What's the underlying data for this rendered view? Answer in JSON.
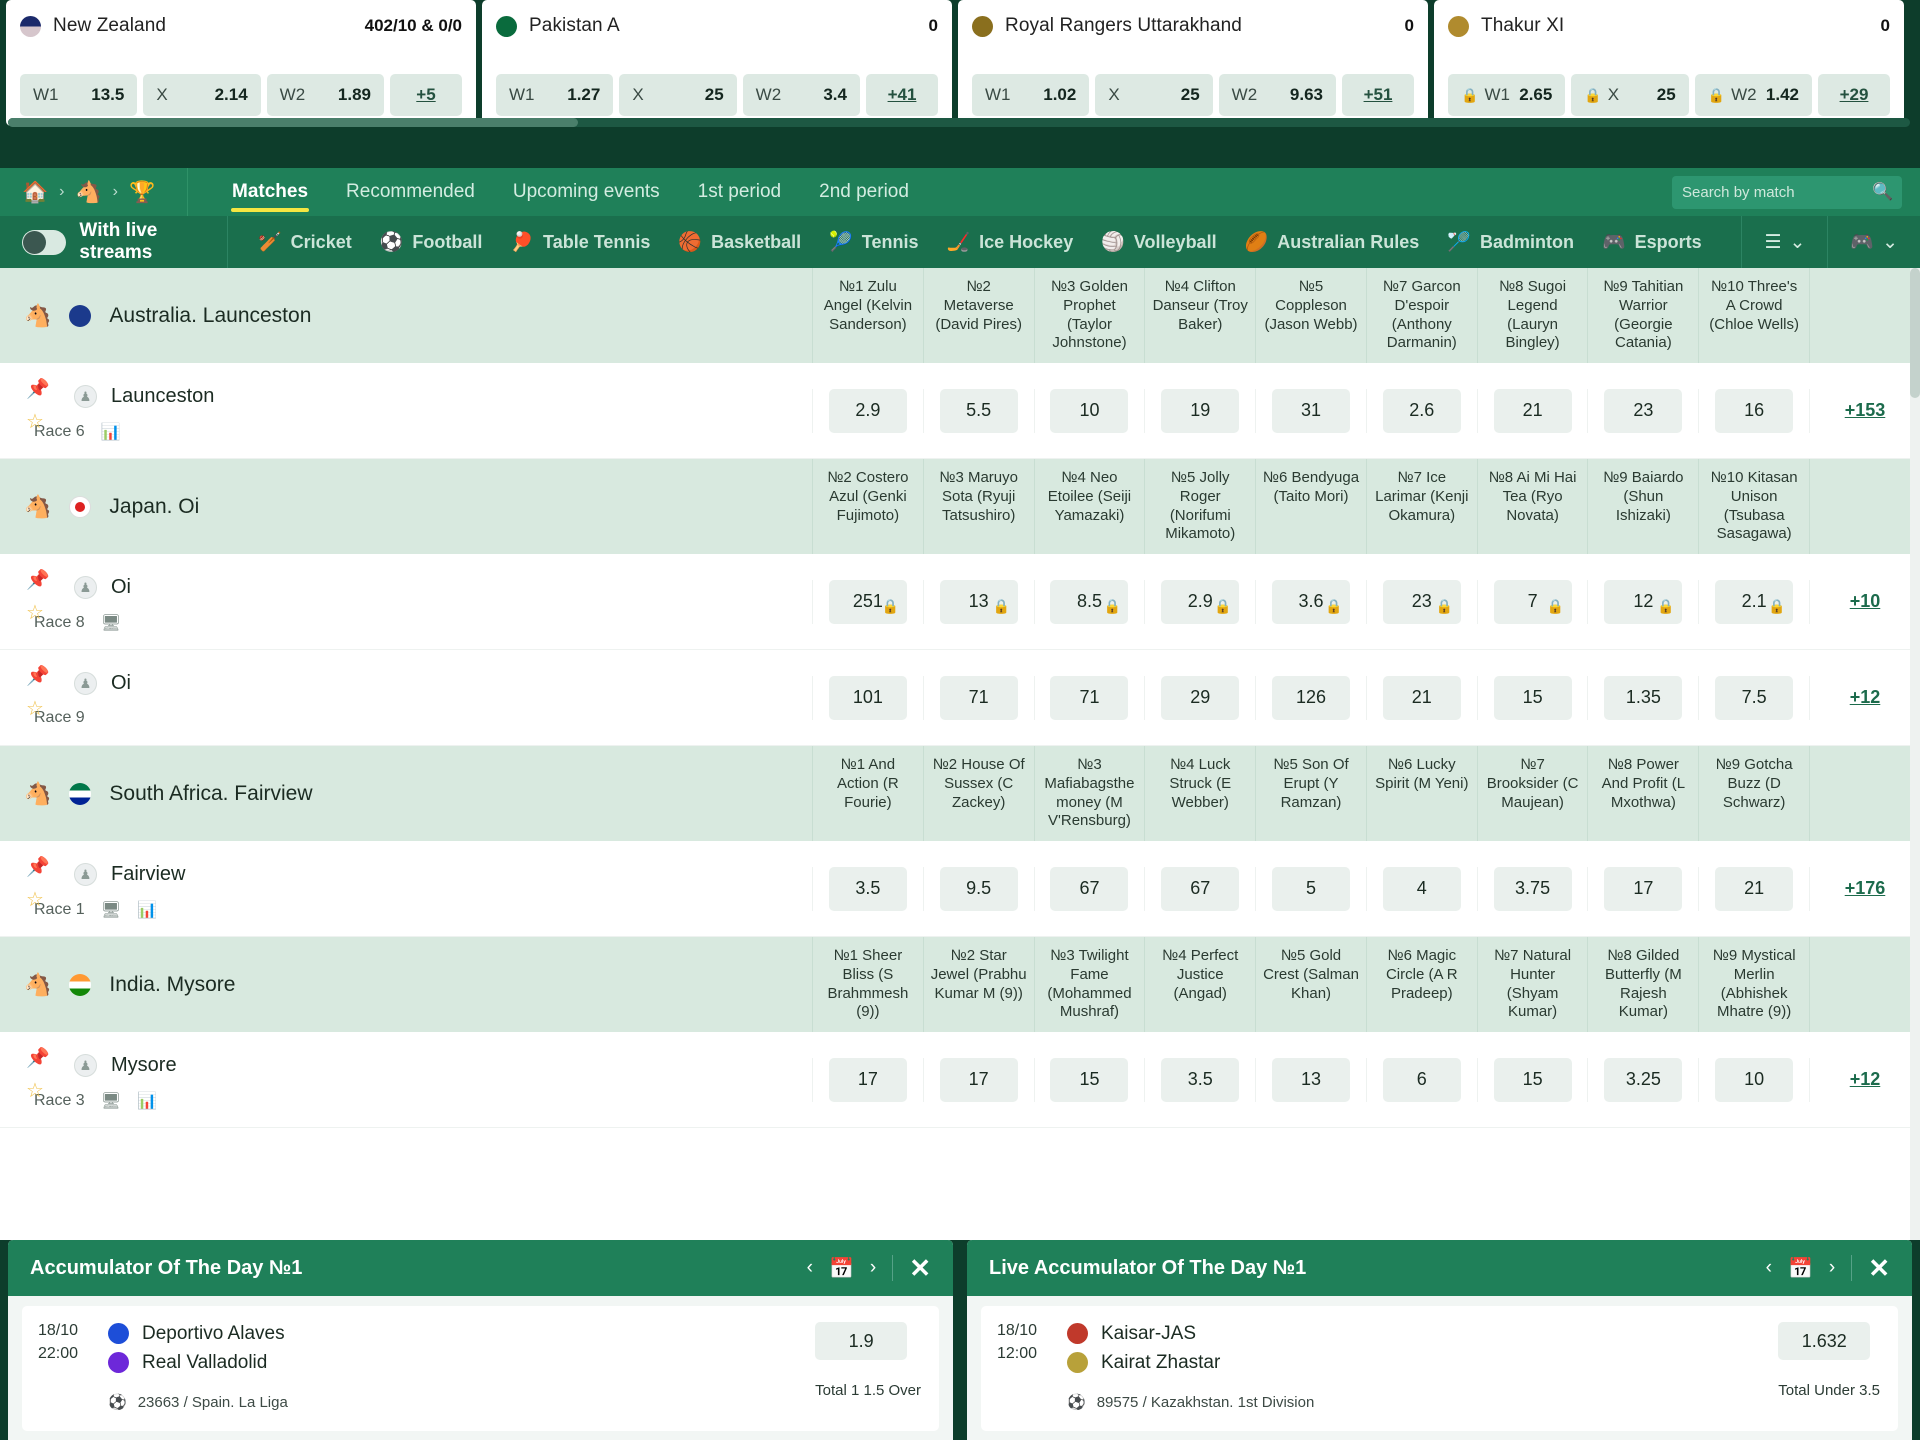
{
  "live_strip": {
    "matches": [
      {
        "team": "New Zealand",
        "flag": "nz",
        "score": "402/10 & 0/0",
        "odds": [
          {
            "label": "W1",
            "value": "13.5",
            "locked": false
          },
          {
            "label": "X",
            "value": "2.14",
            "locked": false
          },
          {
            "label": "W2",
            "value": "1.89",
            "locked": false
          }
        ],
        "more": "+5"
      },
      {
        "team": "Pakistan A",
        "flag": "pk",
        "score": "0",
        "odds": [
          {
            "label": "W1",
            "value": "1.27",
            "locked": false
          },
          {
            "label": "X",
            "value": "25",
            "locked": false
          },
          {
            "label": "W2",
            "value": "3.4",
            "locked": false
          }
        ],
        "more": "+41"
      },
      {
        "team": "Royal Rangers Uttarakhand",
        "flag": "rr",
        "score": "0",
        "odds": [
          {
            "label": "W1",
            "value": "1.02",
            "locked": false
          },
          {
            "label": "X",
            "value": "25",
            "locked": false
          },
          {
            "label": "W2",
            "value": "9.63",
            "locked": false
          }
        ],
        "more": "+51"
      },
      {
        "team": "Thakur XI",
        "flag": "tx",
        "score": "0",
        "odds": [
          {
            "label": "W1",
            "value": "2.65",
            "locked": true
          },
          {
            "label": "X",
            "value": "25",
            "locked": true
          },
          {
            "label": "W2",
            "value": "1.42",
            "locked": true
          }
        ],
        "more": "+29"
      }
    ]
  },
  "nav": {
    "breadcrumb": [
      "home-icon",
      "horse-racing-icon",
      "trophy-icon"
    ],
    "tabs": [
      {
        "label": "Matches",
        "active": true
      },
      {
        "label": "Recommended",
        "active": false
      },
      {
        "label": "Upcoming events",
        "active": false
      },
      {
        "label": "1st period",
        "active": false
      },
      {
        "label": "2nd period",
        "active": false
      }
    ],
    "search": {
      "placeholder": "Search by match",
      "value": ""
    }
  },
  "sports_bar": {
    "live_streams_toggle": {
      "label": "With live streams",
      "on": false
    },
    "sports": [
      {
        "label": "Cricket",
        "icon": "cricket-icon"
      },
      {
        "label": "Football",
        "icon": "football-icon"
      },
      {
        "label": "Table Tennis",
        "icon": "table-tennis-icon"
      },
      {
        "label": "Basketball",
        "icon": "basketball-icon"
      },
      {
        "label": "Tennis",
        "icon": "tennis-icon"
      },
      {
        "label": "Ice Hockey",
        "icon": "ice-hockey-icon"
      },
      {
        "label": "Volleyball",
        "icon": "volleyball-icon"
      },
      {
        "label": "Australian Rules",
        "icon": "australian-rules-icon"
      },
      {
        "label": "Badminton",
        "icon": "badminton-icon"
      },
      {
        "label": "Esports",
        "icon": "esports-icon"
      }
    ],
    "right_controls": [
      {
        "icon": "list-icon",
        "chevron": "⌄"
      },
      {
        "icon": "gamepad-icon",
        "chevron": "⌄"
      }
    ]
  },
  "groups": [
    {
      "country": "Australia. Launceston",
      "flag": "au",
      "runners": [
        "№1 Zulu Angel (Kelvin Sanderson)",
        "№2 Metaverse (David Pires)",
        "№3 Golden Prophet (Taylor Johnstone)",
        "№4 Clifton Danseur (Troy Baker)",
        "№5 Coppleson (Jason Webb)",
        "№7 Garcon D'espoir (Anthony Darmanin)",
        "№8 Sugoi Legend (Lauryn Bingley)",
        "№9 Tahitian Warrior (Georgie Catania)",
        "№10 Three's A Crowd (Chloe Wells)"
      ],
      "events": [
        {
          "name": "Launceston",
          "race": "Race 6",
          "meta_icons": [
            "stats-icon"
          ],
          "odds": [
            "2.9",
            "5.5",
            "10",
            "19",
            "31",
            "2.6",
            "21",
            "23",
            "16"
          ],
          "locked": false,
          "more": "+153"
        }
      ]
    },
    {
      "country": "Japan. Oi",
      "flag": "jp",
      "runners": [
        "№2 Costero Azul (Genki Fujimoto)",
        "№3 Maruyo Sota (Ryuji Tatsushiro)",
        "№4 Neo Etoilee (Seiji Yamazaki)",
        "№5 Jolly Roger (Norifumi Mikamoto)",
        "№6 Bendyuga (Taito Mori)",
        "№7 Ice Larimar (Kenji Okamura)",
        "№8 Ai Mi Hai Tea (Ryo Novata)",
        "№9 Baiardo (Shun Ishizaki)",
        "№10 Kitasan Unison (Tsubasa Sasagawa)"
      ],
      "events": [
        {
          "name": "Oi",
          "race": "Race 8",
          "meta_icons": [
            "stream-icon"
          ],
          "odds": [
            "251",
            "13",
            "8.5",
            "2.9",
            "3.6",
            "23",
            "7",
            "12",
            "2.1"
          ],
          "locked": true,
          "more": "+10"
        },
        {
          "name": "Oi",
          "race": "Race 9",
          "meta_icons": [],
          "odds": [
            "101",
            "71",
            "71",
            "29",
            "126",
            "21",
            "15",
            "1.35",
            "7.5"
          ],
          "locked": false,
          "more": "+12"
        }
      ]
    },
    {
      "country": "South Africa. Fairview",
      "flag": "za",
      "runners": [
        "№1 And Action (R Fourie)",
        "№2 House Of Sussex (C Zackey)",
        "№3 Mafiabagsthemoney (M V'Rensburg)",
        "№4 Luck Struck (E Webber)",
        "№5 Son Of Erupt (Y Ramzan)",
        "№6 Lucky Spirit (M Yeni)",
        "№7 Brooksider (C Maujean)",
        "№8 Power And Profit (L Mxothwa)",
        "№9 Gotcha Buzz (D Schwarz)"
      ],
      "events": [
        {
          "name": "Fairview",
          "race": "Race 1",
          "meta_icons": [
            "stream-icon",
            "stats-icon"
          ],
          "odds": [
            "3.5",
            "9.5",
            "67",
            "67",
            "5",
            "4",
            "3.75",
            "17",
            "21"
          ],
          "locked": false,
          "more": "+176"
        }
      ]
    },
    {
      "country": "India. Mysore",
      "flag": "in",
      "runners": [
        "№1 Sheer Bliss (S Brahmmesh (9))",
        "№2 Star Jewel (Prabhu Kumar M (9))",
        "№3 Twilight Fame (Mohammed Mushraf)",
        "№4 Perfect Justice (Angad)",
        "№5 Gold Crest (Salman Khan)",
        "№6 Magic Circle (A R Pradeep)",
        "№7 Natural Hunter (Shyam Kumar)",
        "№8 Gilded Butterfly (M Rajesh Kumar)",
        "№9 Mystical Merlin (Abhishek Mhatre (9))"
      ],
      "events": [
        {
          "name": "Mysore",
          "race": "Race 3",
          "meta_icons": [
            "stream-icon",
            "stats-icon"
          ],
          "odds": [
            "17",
            "17",
            "15",
            "3.5",
            "13",
            "6",
            "15",
            "3.25",
            "10"
          ],
          "locked": false,
          "more": "+12"
        }
      ]
    }
  ],
  "accumulators": [
    {
      "title": "Accumulator Of The Day №1",
      "date": "18/10",
      "time": "22:00",
      "team1": "Deportivo Alaves",
      "team2": "Real Valladolid",
      "team1_class": "alaves",
      "team2_class": "vall",
      "league": "23663 / Spain. La Liga",
      "odd": "1.9",
      "bet": "Total 1 1.5 Over"
    },
    {
      "title": "Live Accumulator Of The Day №1",
      "date": "18/10",
      "time": "12:00",
      "team1": "Kaisar-JAS",
      "team2": "Kairat Zhastar",
      "team1_class": "kaisar",
      "team2_class": "kairat",
      "league": "89575 / Kazakhstan. 1st Division",
      "odd": "1.632",
      "bet": "Total Under 3.5"
    }
  ],
  "colors": {
    "brand_green": "#1f8059",
    "dark_green": "#0d3d2b",
    "group_row": "#d8e9df",
    "odds_chip": "#eaf0ed",
    "accent_yellow": "#f5e642"
  }
}
